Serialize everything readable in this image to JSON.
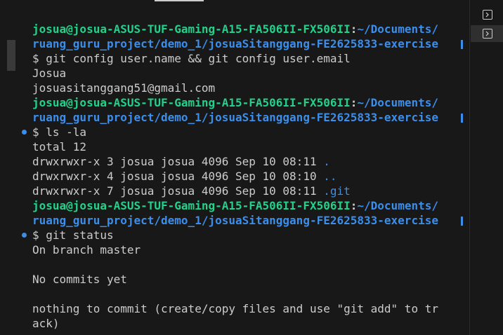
{
  "terminal": {
    "prompt_user": "josua@josua-ASUS-TUF-Gaming-A15-FA506II-FX506II",
    "prompt_sep": ":",
    "prompt_path_line1": "~/Documents/",
    "prompt_path_line2": "ruang_guru_project/demo_1/josuaSitanggang-FE2625833-exercise",
    "prompt_symbol": "$ ",
    "commands": {
      "git_config": "git config user.name && git config user.email",
      "ls": "ls -la",
      "git_status": "git status"
    },
    "output": {
      "name": "Josua",
      "email": "josuasitanggang51@gmail.com",
      "ls_total": "total 12",
      "ls_rows": [
        {
          "meta": "drwxrwxr-x 3 josua josua 4096 Sep 10 08:11 ",
          "name": "."
        },
        {
          "meta": "drwxrwxr-x 4 josua josua 4096 Sep 10 08:10 ",
          "name": ".."
        },
        {
          "meta": "drwxrwxr-x 7 josua josua 4096 Sep 10 08:11 ",
          "name": ".git"
        }
      ],
      "status_branch": "On branch master",
      "status_commits": "No commits yet",
      "status_nothing_1": "nothing to commit (create/copy files and use \"git add\" to tr",
      "status_nothing_2": "ack)"
    }
  },
  "side_tabs": [
    {
      "icon": "terminal-icon",
      "active": false
    },
    {
      "icon": "terminal-icon",
      "active": true
    }
  ],
  "colors": {
    "background": "#181818",
    "prompt_user": "#23d18b",
    "prompt_path": "#3b8eea",
    "text": "#cccccc"
  }
}
